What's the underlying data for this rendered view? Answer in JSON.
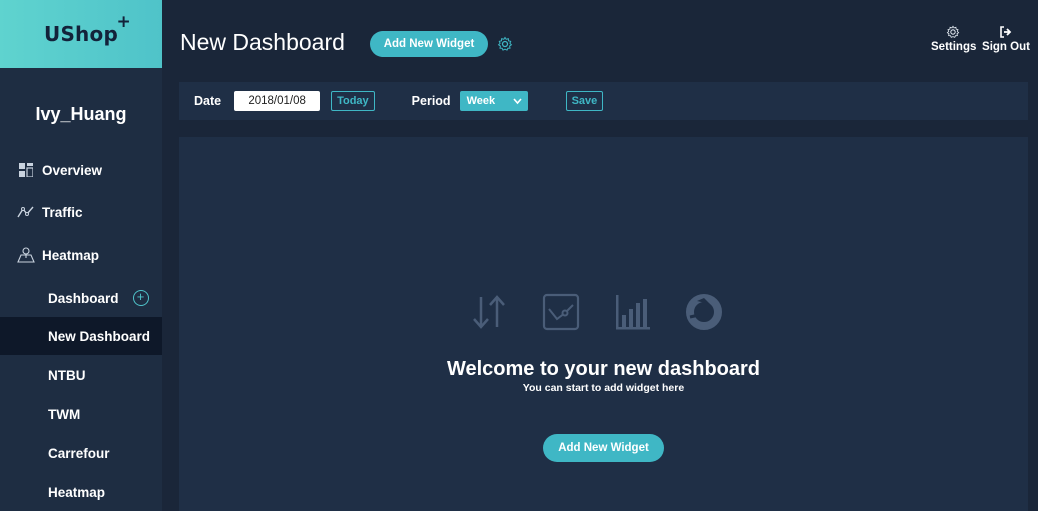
{
  "app": {
    "logo": "UShop",
    "logo_plus": "+",
    "user_name": "Ivy_Huang",
    "accent_color": "#3fb7c5",
    "logo_color": "#5fd3cf"
  },
  "sidebar": {
    "main_items": [
      {
        "label": "Overview",
        "icon": "overview-grid-icon"
      },
      {
        "label": "Traffic",
        "icon": "traffic-line-icon"
      },
      {
        "label": "Heatmap",
        "icon": "heatmap-map-icon"
      }
    ],
    "sub_items": [
      {
        "label": "Dashboard"
      },
      {
        "label": "New Dashboard"
      },
      {
        "label": "NTBU"
      },
      {
        "label": "TWM"
      },
      {
        "label": "Carrefour"
      },
      {
        "label": "Heatmap"
      }
    ],
    "active_sub": "New Dashboard"
  },
  "header": {
    "title": "New Dashboard",
    "add_widget_label": "Add New Widget",
    "settings_label": "Settings",
    "signout_label": "Sign Out"
  },
  "filters": {
    "date_label": "Date",
    "date_value": "2018/01/08",
    "today_label": "Today",
    "period_label": "Period",
    "period_value": "Week",
    "save_label": "Save"
  },
  "main": {
    "welcome_title": "Welcome to your new dashboard",
    "welcome_sub": "You can start to add widget here",
    "add_widget_label": "Add New Widget",
    "placeholder_icons": [
      "sort-arrows-icon",
      "line-chart-icon",
      "bar-chart-icon",
      "donut-chart-icon"
    ]
  }
}
